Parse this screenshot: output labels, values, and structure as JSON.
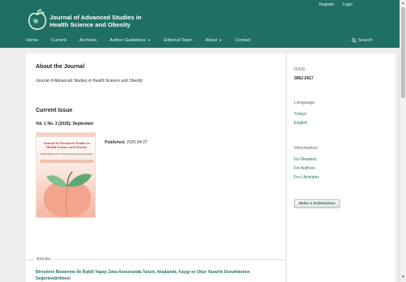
{
  "header": {
    "topnav": {
      "register": "Register",
      "login": "Login"
    },
    "title_line1": "Journal of Advanced Studies in",
    "title_line2": "Health Science and Obesity",
    "nav": {
      "home": "Home",
      "current": "Current",
      "archives": "Archives",
      "author_guidelines": "Author Guidelines",
      "editorial_team": "Editorial Team",
      "about": "About",
      "search": "Search"
    },
    "colors": {
      "brand": "#1f6f64",
      "background": "#eeeeee"
    }
  },
  "main": {
    "about_heading": "About the Journal",
    "about_text": "Journal of Advanced Studies in Health Science and Obesity",
    "current_issue_heading": "Current Issue",
    "issue_title": "Vol. 1 No. 3 (2025): September",
    "cover": {
      "title": "Journal of Advanced Studies in Health Science and Obesity",
      "subtitle": "Sağlık Bilimlerinde ve Obezitede İleri Çalışmalar Dergisi"
    },
    "published_label": "Published:",
    "published_date": "2025-09-27",
    "articles_label": "Articles",
    "article_title": "Bireylerin Beslenme İle İlişkili Yapay Zeka Konusunda Tutum, Alışkanlık, Kaygı ve Okur Yazarlık Durumlarının Değerlendirilmesi"
  },
  "sidebar": {
    "issn_heading": "ISSN",
    "issn_value": "3062-2417",
    "language_heading": "Language",
    "languages": [
      "Türkçe",
      "English"
    ],
    "information_heading": "Information",
    "information_links": [
      "For Readers",
      "For Authors",
      "For Librarians"
    ],
    "submit_button": "Make a Submission"
  }
}
